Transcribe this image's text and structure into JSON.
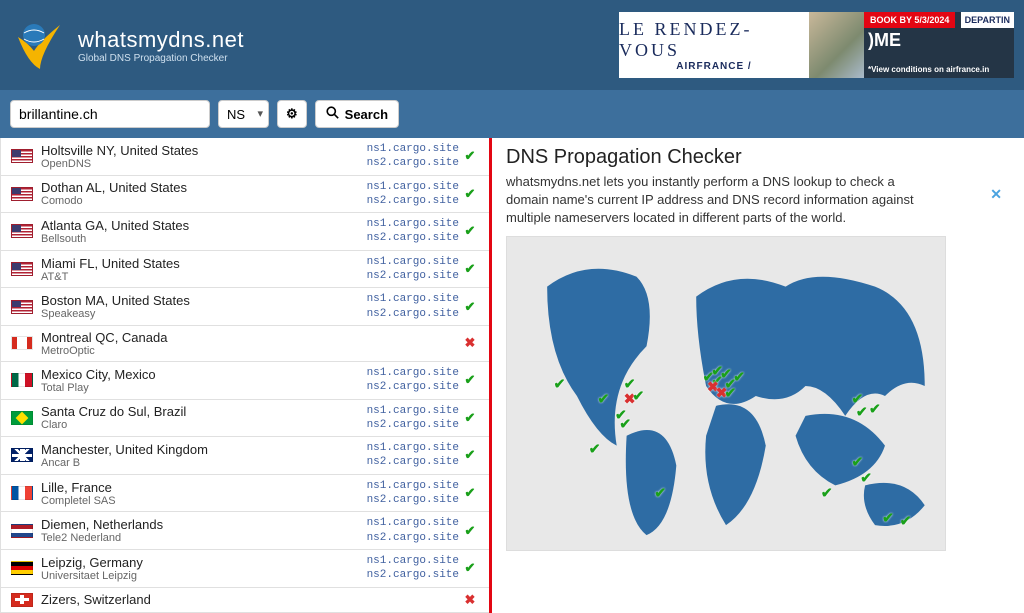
{
  "brand": {
    "name": "whatsmydns.net",
    "tagline": "Global DNS Propagation Checker"
  },
  "ad": {
    "line1": "LE RENDEZ-VOUS",
    "line2": "AIRFRANCE /",
    "book": "BOOK BY 5/3/2024",
    "depart": "DEPARTIN",
    "ome": ")ME",
    "conditions": "*View conditions on airfrance.in"
  },
  "search": {
    "domain_value": "brillantine.ch",
    "record_type": "NS",
    "button": "Search"
  },
  "ns_pair": [
    "ns1.cargo.site",
    "ns2.cargo.site"
  ],
  "results": [
    {
      "flag": "us",
      "city": "Holtsville NY, United States",
      "provider": "OpenDNS",
      "records": true,
      "ok": true
    },
    {
      "flag": "us",
      "city": "Dothan AL, United States",
      "provider": "Comodo",
      "records": true,
      "ok": true
    },
    {
      "flag": "us",
      "city": "Atlanta GA, United States",
      "provider": "Bellsouth",
      "records": true,
      "ok": true
    },
    {
      "flag": "us",
      "city": "Miami FL, United States",
      "provider": "AT&T",
      "records": true,
      "ok": true
    },
    {
      "flag": "us",
      "city": "Boston MA, United States",
      "provider": "Speakeasy",
      "records": true,
      "ok": true
    },
    {
      "flag": "ca",
      "city": "Montreal QC, Canada",
      "provider": "MetroOptic",
      "records": false,
      "ok": false
    },
    {
      "flag": "mx",
      "city": "Mexico City, Mexico",
      "provider": "Total Play",
      "records": true,
      "ok": true
    },
    {
      "flag": "br",
      "city": "Santa Cruz do Sul, Brazil",
      "provider": "Claro",
      "records": true,
      "ok": true
    },
    {
      "flag": "gb",
      "city": "Manchester, United Kingdom",
      "provider": "Ancar B",
      "records": true,
      "ok": true
    },
    {
      "flag": "fr",
      "city": "Lille, France",
      "provider": "Completel SAS",
      "records": true,
      "ok": true
    },
    {
      "flag": "nl",
      "city": "Diemen, Netherlands",
      "provider": "Tele2 Nederland",
      "records": true,
      "ok": true
    },
    {
      "flag": "de",
      "city": "Leipzig, Germany",
      "provider": "Universitaet Leipzig",
      "records": true,
      "ok": true
    },
    {
      "flag": "ch",
      "city": "Zizers, Switzerland",
      "provider": "",
      "records": false,
      "ok": false
    }
  ],
  "info": {
    "heading": "DNS Propagation Checker",
    "body": "whatsmydns.net lets you instantly perform a DNS lookup to check a domain name's current IP address and DNS record information against multiple nameservers located in different parts of the world."
  },
  "markers": [
    {
      "x": 12,
      "y": 47,
      "ok": true
    },
    {
      "x": 22,
      "y": 52,
      "ok": true
    },
    {
      "x": 26,
      "y": 57,
      "ok": true
    },
    {
      "x": 28,
      "y": 52,
      "ok": false
    },
    {
      "x": 27,
      "y": 60,
      "ok": true
    },
    {
      "x": 28,
      "y": 47,
      "ok": true
    },
    {
      "x": 30,
      "y": 51,
      "ok": true
    },
    {
      "x": 20,
      "y": 68,
      "ok": true
    },
    {
      "x": 35,
      "y": 82,
      "ok": true
    },
    {
      "x": 46,
      "y": 45,
      "ok": true
    },
    {
      "x": 48,
      "y": 46,
      "ok": true
    },
    {
      "x": 47,
      "y": 48,
      "ok": false
    },
    {
      "x": 49,
      "y": 50,
      "ok": false
    },
    {
      "x": 48,
      "y": 43,
      "ok": true
    },
    {
      "x": 50,
      "y": 44,
      "ok": true
    },
    {
      "x": 51,
      "y": 47,
      "ok": true
    },
    {
      "x": 53,
      "y": 45,
      "ok": true
    },
    {
      "x": 51,
      "y": 50,
      "ok": true
    },
    {
      "x": 73,
      "y": 82,
      "ok": true
    },
    {
      "x": 80,
      "y": 52,
      "ok": true
    },
    {
      "x": 81,
      "y": 56,
      "ok": true
    },
    {
      "x": 80,
      "y": 72,
      "ok": true
    },
    {
      "x": 82,
      "y": 77,
      "ok": true
    },
    {
      "x": 84,
      "y": 55,
      "ok": true
    },
    {
      "x": 87,
      "y": 90,
      "ok": true
    },
    {
      "x": 91,
      "y": 91,
      "ok": true
    }
  ],
  "colors": {
    "brand_blue": "#2e5a80",
    "ok": "#1aa01a",
    "fail": "#d93030",
    "highlight": "#e30613"
  }
}
